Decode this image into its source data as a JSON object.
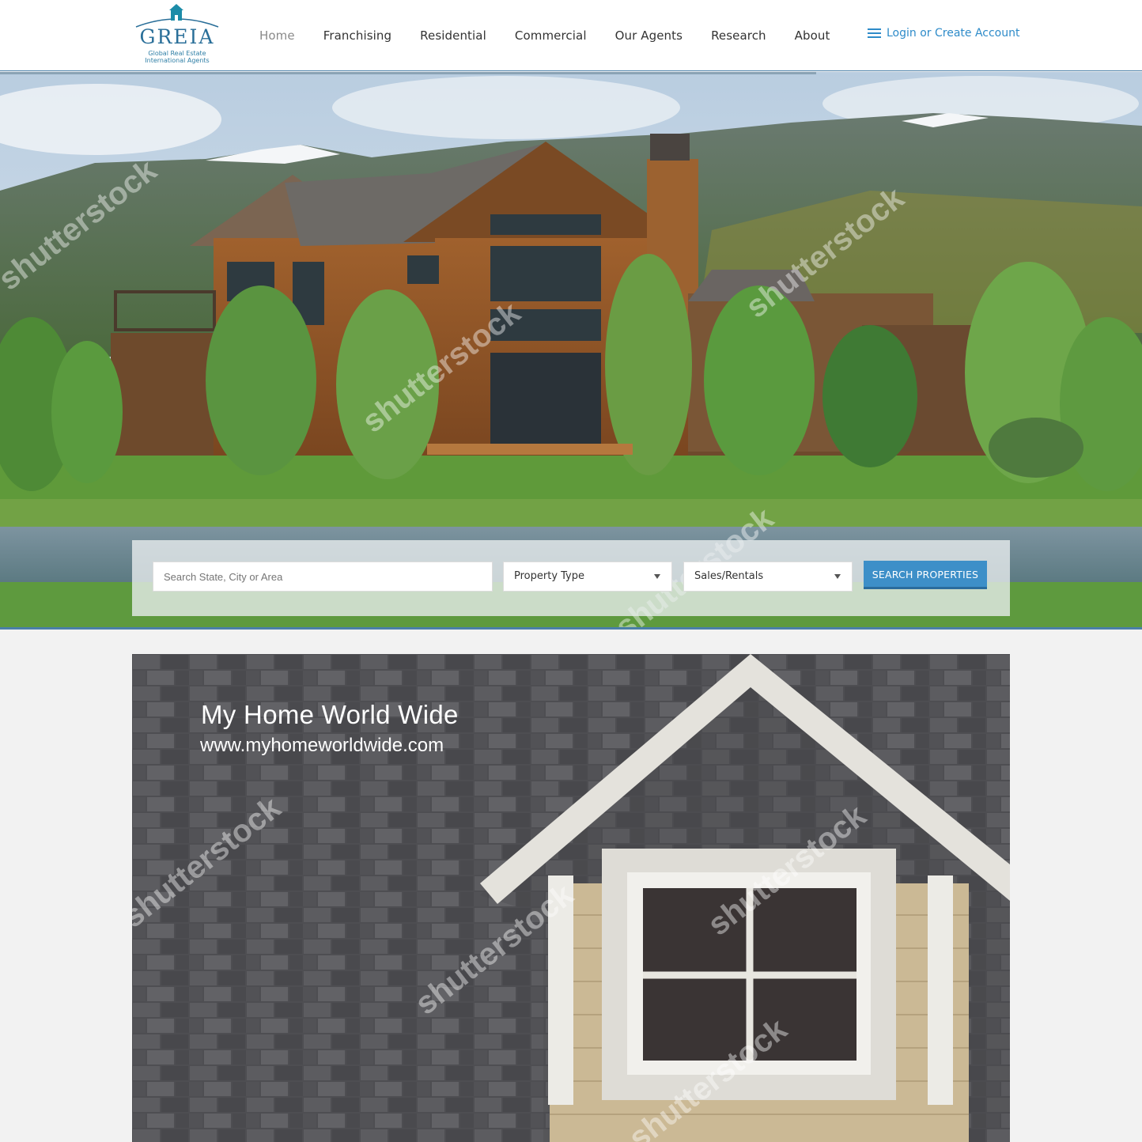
{
  "logo": {
    "name": "GREIA",
    "tagline_1": "Global Real Estate",
    "tagline_2": "International Agents"
  },
  "nav": {
    "items": [
      {
        "label": "Home",
        "active": true
      },
      {
        "label": "Franchising"
      },
      {
        "label": "Residential"
      },
      {
        "label": "Commercial"
      },
      {
        "label": "Our Agents"
      },
      {
        "label": "Research"
      },
      {
        "label": "About"
      }
    ],
    "login_label": "Login or Create Account"
  },
  "search": {
    "location_placeholder": "Search State, City or Area",
    "property_type": "Property Type",
    "sales_rentals": "Sales/Rentals",
    "button_label": "SEARCH PROPERTIES"
  },
  "banner": {
    "title": "My Home World Wide",
    "url": "www.myhomeworldwide.com"
  },
  "watermark": "shutterstock",
  "colors": {
    "accent": "#3d8fc8",
    "nav_text": "#333333",
    "link": "#2e8bc9",
    "logo": "#2a6f99"
  }
}
